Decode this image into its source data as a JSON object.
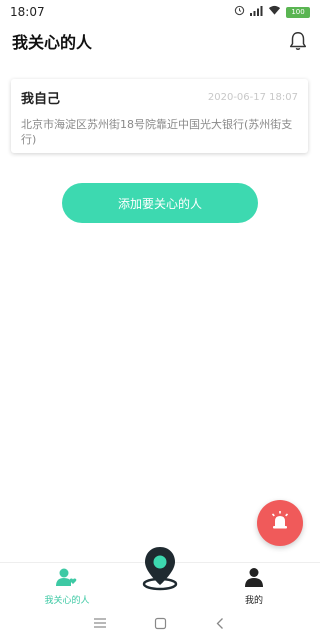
{
  "status_bar": {
    "time": "18:07",
    "battery": "100"
  },
  "header": {
    "title": "我关心的人",
    "bell_icon": "bell-icon"
  },
  "card": {
    "name": "我自己",
    "timestamp": "2020-06-17 18:07",
    "address": "北京市海淀区苏州街18号院靠近中国光大银行(苏州街支行)"
  },
  "add_button": {
    "label": "添加要关心的人"
  },
  "sos": {
    "icon": "alarm-siren-icon",
    "color": "#f05a5a"
  },
  "tabbar": {
    "tabs": [
      {
        "label": "我关心的人",
        "icon": "people-heart-icon",
        "active": true
      },
      {
        "label": "",
        "icon": "location-pin-icon",
        "active": false
      },
      {
        "label": "我的",
        "icon": "person-icon",
        "active": false
      }
    ]
  },
  "navbar": {
    "keys": [
      "menu-icon",
      "home-square-icon",
      "back-chevron-icon"
    ]
  },
  "colors": {
    "accent": "#3dd9b0",
    "accent_text": "#3dc9a4",
    "alert": "#f05a5a"
  }
}
